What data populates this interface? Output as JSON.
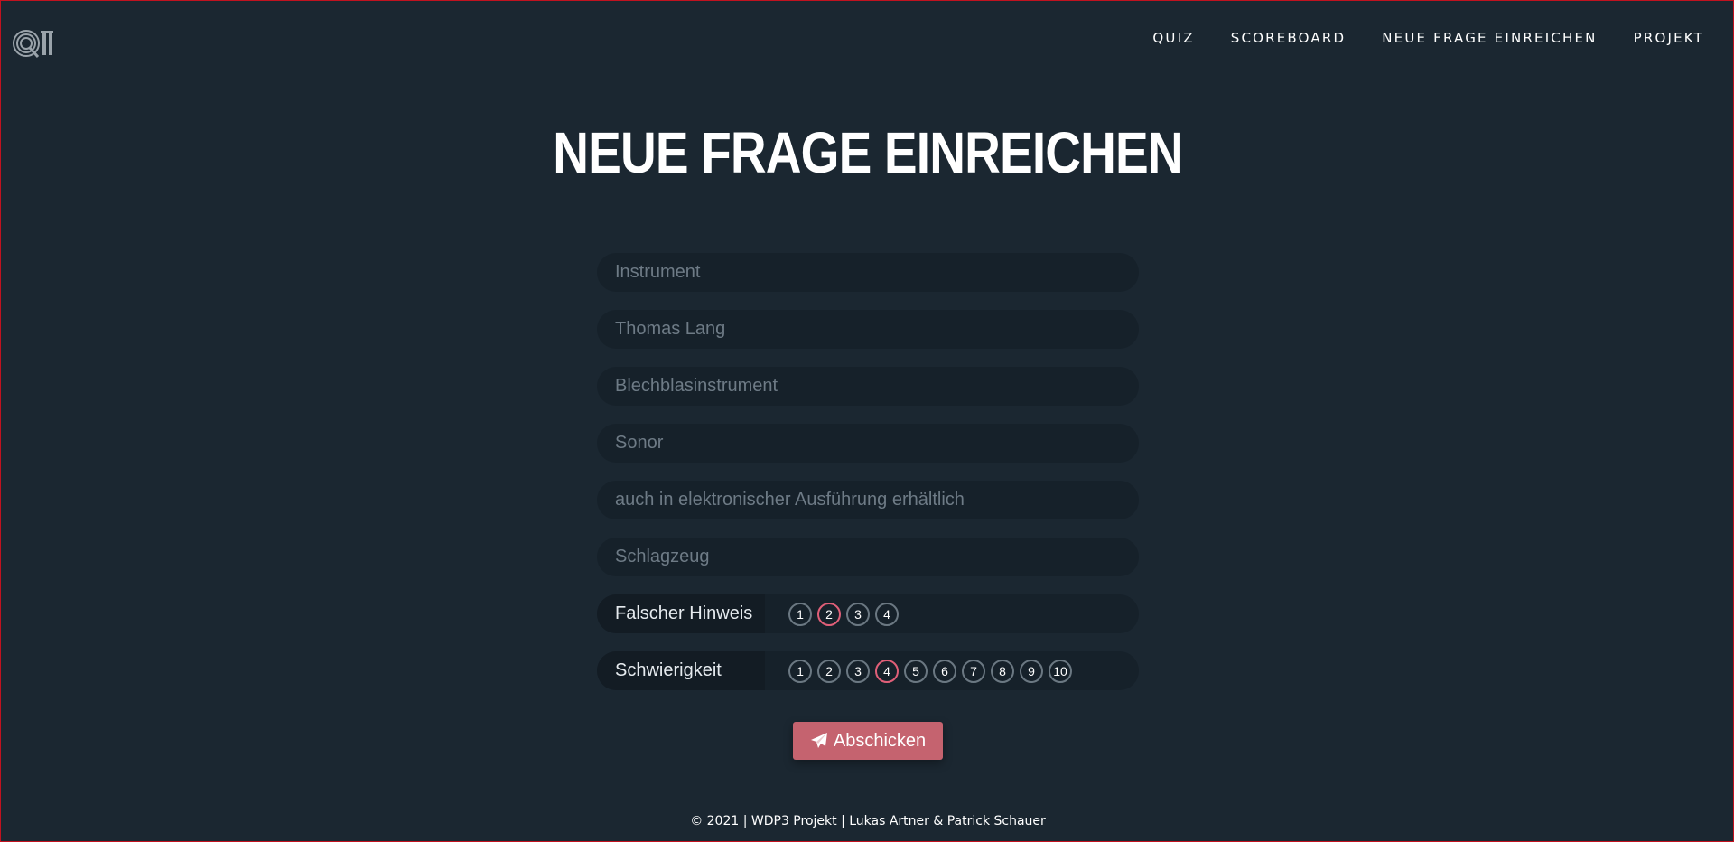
{
  "nav": {
    "items": [
      {
        "label": "QUIZ"
      },
      {
        "label": "SCOREBOARD"
      },
      {
        "label": "NEUE FRAGE EINREICHEN"
      },
      {
        "label": "PROJEKT"
      }
    ]
  },
  "page_title": "NEUE FRAGE EINREICHEN",
  "form": {
    "fields": [
      {
        "value": "",
        "placeholder": "Instrument"
      },
      {
        "value": "",
        "placeholder": "Thomas Lang"
      },
      {
        "value": "",
        "placeholder": "Blechblasinstrument"
      },
      {
        "value": "",
        "placeholder": "Sonor"
      },
      {
        "value": "",
        "placeholder": "auch in elektronischer Ausführung erhältlich"
      },
      {
        "value": "",
        "placeholder": "Schlagzeug"
      }
    ],
    "wrong_hint": {
      "label": "Falscher Hinweis",
      "options": [
        "1",
        "2",
        "3",
        "4"
      ],
      "selected": "2"
    },
    "difficulty": {
      "label": "Schwierigkeit",
      "options": [
        "1",
        "2",
        "3",
        "4",
        "5",
        "6",
        "7",
        "8",
        "9",
        "10"
      ],
      "selected": "4"
    },
    "submit_label": "Abschicken",
    "submit_icon": "paper-plane-icon"
  },
  "footer": "© 2021 | WDP3 Projekt | Lukas Artner & Patrick Schauer",
  "colors": {
    "background": "#1b2731",
    "field_background": "#16212a",
    "accent": "#c5636f",
    "selected_ring": "#e05f78"
  }
}
